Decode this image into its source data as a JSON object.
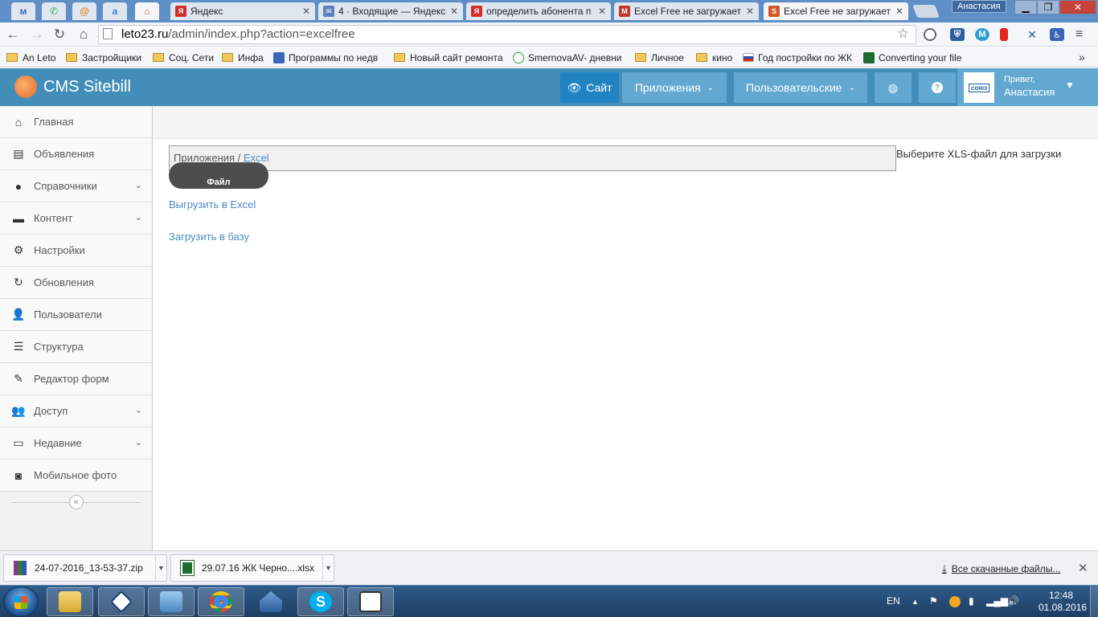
{
  "browser": {
    "tabs": [
      {
        "title": "Яндекс",
        "fav": "Я",
        "color": "#d02e2e"
      },
      {
        "title": "4 · Входящие — Яндекс",
        "fav": "✉",
        "color": "#5b7fbf"
      },
      {
        "title": "определить абонента п",
        "fav": "Я",
        "color": "#d02e2e"
      },
      {
        "title": "Excel Free не загружает",
        "fav": "M",
        "color": "#c5372c"
      },
      {
        "title": "Excel Free не загружает",
        "fav": "S",
        "color": "#d0582a"
      }
    ],
    "profile_name": "Анастасия",
    "url_domain": "leto23.ru",
    "url_path": "/admin/index.php?action=excelfree",
    "bookmarks": [
      {
        "label": "An Leto",
        "icon": "folder"
      },
      {
        "label": "Застройщики",
        "icon": "folder"
      },
      {
        "label": "Соц. Сети",
        "icon": "folder"
      },
      {
        "label": "Инфа",
        "icon": "folder"
      },
      {
        "label": "Программы по недв",
        "icon": "site-icon"
      },
      {
        "label": "Новый сайт ремонта",
        "icon": "folder"
      },
      {
        "label": "SmernovaAV- дневни",
        "icon": "site-icon"
      },
      {
        "label": "Личное",
        "icon": "folder"
      },
      {
        "label": "кино",
        "icon": "folder"
      },
      {
        "label": "Год постройки по ЖК",
        "icon": "flag-icon"
      },
      {
        "label": "Converting your file",
        "icon": "excel-icon"
      }
    ],
    "bookmarks_more": "»"
  },
  "header": {
    "brand": "CMS Sitebill",
    "site_label": "Сайт",
    "apps_label": "Приложения",
    "users_label": "Пользовательские",
    "hello_line1": "Привет,",
    "hello_line2": "Анастасия",
    "avatar_text": "союз"
  },
  "sidebar": {
    "items": [
      {
        "label": "Главная",
        "icon": "home-icon",
        "has_sub": false
      },
      {
        "label": "Объявления",
        "icon": "book-icon",
        "has_sub": false
      },
      {
        "label": "Справочники",
        "icon": "globe-icon",
        "has_sub": true
      },
      {
        "label": "Контент",
        "icon": "keyboard-icon",
        "has_sub": true
      },
      {
        "label": "Настройки",
        "icon": "gear-icon",
        "has_sub": false
      },
      {
        "label": "Обновления",
        "icon": "refresh-icon",
        "has_sub": false
      },
      {
        "label": "Пользователи",
        "icon": "user-icon",
        "has_sub": false
      },
      {
        "label": "Структура",
        "icon": "list-icon",
        "has_sub": false
      },
      {
        "label": "Редактор форм",
        "icon": "edit-icon",
        "has_sub": false
      },
      {
        "label": "Доступ",
        "icon": "users-icon",
        "has_sub": true
      },
      {
        "label": "Недавние",
        "icon": "monitor-icon",
        "has_sub": true
      },
      {
        "label": "Мобильное фото",
        "icon": "camera-icon",
        "has_sub": false
      }
    ]
  },
  "main": {
    "breadcrumb_root": "Приложения",
    "breadcrumb_sep": " / ",
    "breadcrumb_current": "Excel",
    "file_hint": "Выберите XLS-файл для загрузки",
    "file_button": "Файл",
    "export_link": "Выгрузить в Excel",
    "import_link": "Загрузить в базу"
  },
  "downloads": {
    "files": [
      {
        "name": "24-07-2016_13-53-37.zip",
        "icon": "zip-icon"
      },
      {
        "name": "29.07.16 ЖК Черно....xlsx",
        "icon": "xlsx-icon"
      }
    ],
    "all_label": "Все скачанные файлы..."
  },
  "taskbar": {
    "lang": "EN",
    "time": "12:48",
    "date": "01.08.2016"
  }
}
